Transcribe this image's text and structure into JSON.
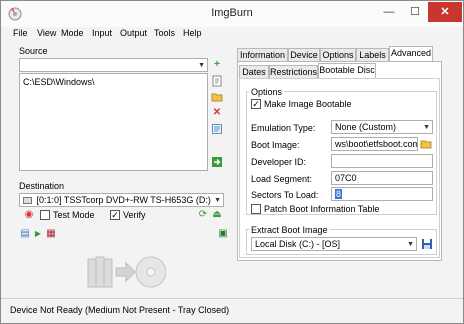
{
  "window": {
    "title": "ImgBurn",
    "minimize": "—",
    "maximize": "☐",
    "close": "✕"
  },
  "menu": [
    "File",
    "View",
    "Mode",
    "Input",
    "Output",
    "Tools",
    "Help"
  ],
  "source": {
    "label": "Source",
    "selected": "",
    "list_items": [
      "C:\\ESD\\Windows\\"
    ]
  },
  "destination": {
    "label": "Destination",
    "drive": "[0:1:0] TSSTcorp DVD+-RW TS-H653G (D:)",
    "test_mode_label": "Test Mode",
    "test_mode_checked": false,
    "verify_label": "Verify",
    "verify_checked": true
  },
  "tabs_top": [
    "Information",
    "Device",
    "Options",
    "Labels",
    "Advanced"
  ],
  "tabs_top_active": "Advanced",
  "tabs_sub": [
    "Dates",
    "Restrictions",
    "Bootable Disc"
  ],
  "tabs_sub_active": "Bootable Disc",
  "options": {
    "group_label": "Options",
    "make_bootable_label": "Make Image Bootable",
    "make_bootable_checked": true,
    "emulation_label": "Emulation Type:",
    "emulation_value": "None (Custom)",
    "boot_image_label": "Boot Image:",
    "boot_image_value": "ws\\boot\\etfsboot.com",
    "developer_id_label": "Developer ID:",
    "developer_id_value": "",
    "load_segment_label": "Load Segment:",
    "load_segment_value": "07C0",
    "sectors_label": "Sectors To Load:",
    "sectors_value": "8",
    "patch_label": "Patch Boot Information Table",
    "patch_checked": false
  },
  "extract": {
    "group_label": "Extract Boot Image",
    "drive_value": "Local Disk (C:) - [OS]"
  },
  "status": {
    "text": "Device Not Ready (Medium Not Present - Tray Closed)"
  },
  "colors": {
    "close_red": "#c7372f",
    "accent_green": "#3a9b3a",
    "warn_red": "#d33"
  }
}
